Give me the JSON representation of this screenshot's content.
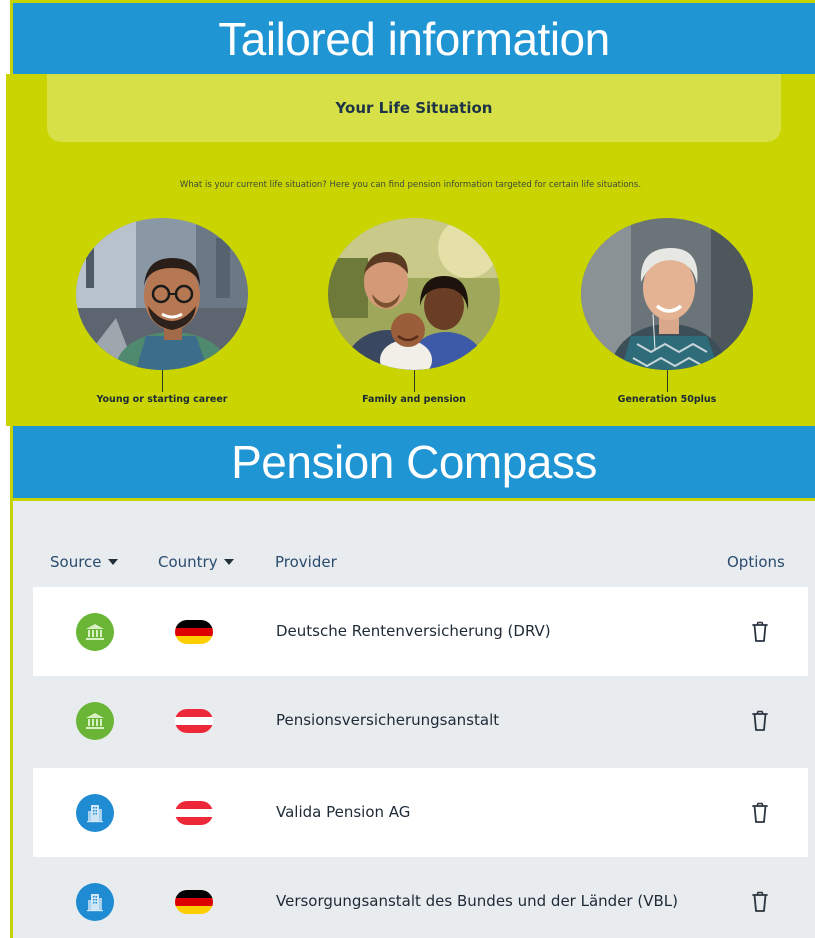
{
  "banners": {
    "top": "Tailored information",
    "middle": "Pension Compass"
  },
  "life": {
    "title": "Your Life Situation",
    "description": "What is your current life situation? Here you can find pension information targeted for certain life situations.",
    "personas": [
      {
        "label": "Young or starting career"
      },
      {
        "label": "Family and pension"
      },
      {
        "label": "Generation 50plus"
      }
    ]
  },
  "compass": {
    "headers": {
      "source": "Source",
      "country": "Country",
      "provider": "Provider",
      "options": "Options"
    },
    "rows": [
      {
        "source_icon": "public-institution-icon",
        "source_color": "#6bb536",
        "flag": "germany",
        "provider": "Deutsche Rentenversicherung (DRV)"
      },
      {
        "source_icon": "public-institution-icon",
        "source_color": "#6bb536",
        "flag": "austria",
        "provider": "Pensionsversicherungsanstalt"
      },
      {
        "source_icon": "company-building-icon",
        "source_color": "#1f8bd2",
        "flag": "austria",
        "provider": "Valida Pension AG"
      },
      {
        "source_icon": "company-building-icon",
        "source_color": "#1f8bd2",
        "flag": "germany",
        "provider": "Versorgungsanstalt des Bundes und der Länder (VBL)"
      }
    ]
  },
  "colors": {
    "banner_blue": "#1f95d4",
    "life_green": "#c9d400",
    "compass_bg": "#e8ecef",
    "public_green": "#6bb536",
    "private_blue": "#1f8bd2"
  }
}
